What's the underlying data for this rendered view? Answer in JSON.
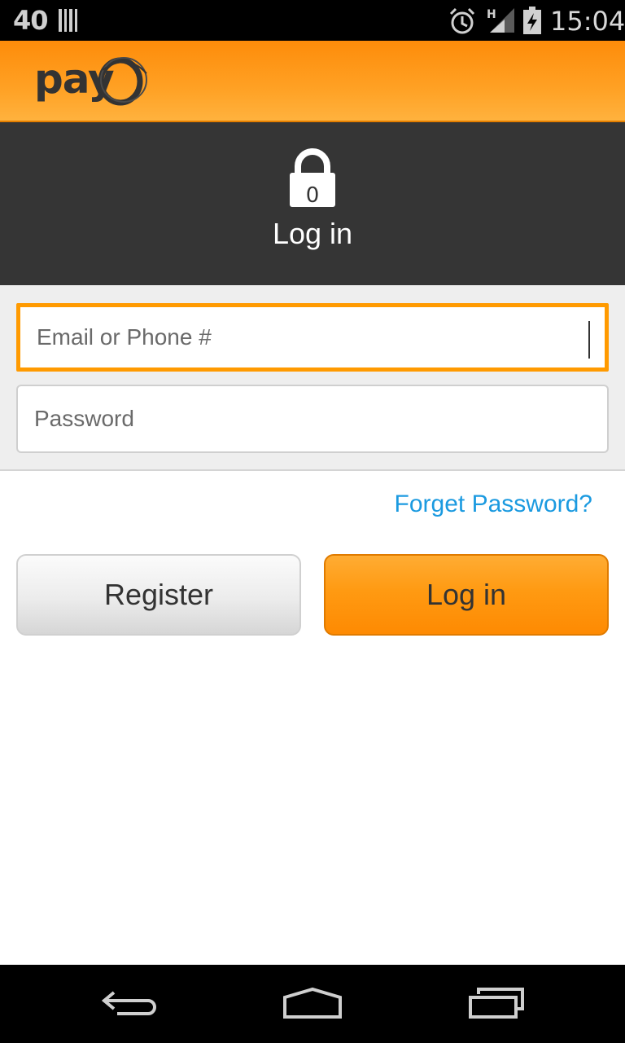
{
  "status_bar": {
    "notification_count": "40",
    "time": "15:04",
    "signal_label": "H",
    "icons": [
      "barcode-icon",
      "alarm-icon",
      "signal-icon",
      "battery-charging-icon"
    ]
  },
  "brand": {
    "logo_text": "pay"
  },
  "hero": {
    "lock_digit": "0",
    "title": "Log in"
  },
  "form": {
    "email_placeholder": "Email or Phone #",
    "password_placeholder": "Password"
  },
  "links": {
    "forget_password": "Forget Password?"
  },
  "buttons": {
    "register_label": "Register",
    "login_label": "Log in"
  },
  "nav": {
    "icons": [
      "back-icon",
      "home-icon",
      "recent-apps-icon"
    ]
  },
  "colors": {
    "accent": "#ff9a00",
    "link": "#1b9ae0",
    "hero_bg": "#353535"
  }
}
